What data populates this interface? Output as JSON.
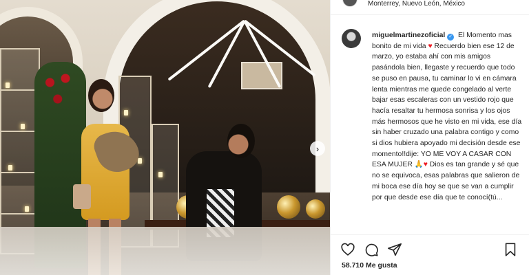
{
  "post": {
    "location": "Monterrey, Nuevo León, México",
    "caption": {
      "username": "miguelmartinezoficial",
      "verified_glyph": "✓",
      "part1": " El Momento mas bonito de mi vida ",
      "heart1": "♥",
      "part2": " Recuerdo bien ese 12 de marzo, yo estaba ahí con mis amigos pasándola bien, llegaste y recuerdo que todo se puso en pausa, tu caminar lo vi en cámara lenta mientras me quede congelado al verte bajar esas escaleras con un vestido rojo que hacía resaltar tu hermosa sonrisa y los ojos más hermosos que he visto en mi vida, ese día sin haber cruzado una palabra contigo y como si dios hubiera apoyado mi decisión desde ese momento!!dije: YO ME VOY A CASAR CON ESA MUJER ",
      "emoji_pray": "🙏",
      "heart2": "♥",
      "part3": " Dios es tan grande y sé que no se equivoca, esas palabras que salieron de mi boca ese día hoy se que se van a cumplir por que desde ese día que te conocí(tú..."
    },
    "likes_text": "58.710 Me gusta",
    "carousel_next_glyph": "›"
  },
  "colors": {
    "verified": "#3897f0",
    "heart": "#ed1c24",
    "text": "#262626"
  },
  "icons": [
    "heart-outline-icon",
    "comment-icon",
    "share-icon",
    "bookmark-icon"
  ]
}
